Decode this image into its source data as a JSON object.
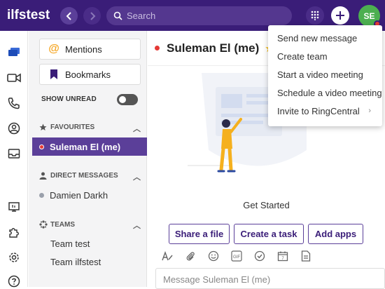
{
  "app": {
    "brand": "ilfstest"
  },
  "topbar": {
    "search_placeholder": "Search",
    "avatar_initials": "SE",
    "colors": {
      "bar": "#3a1d78",
      "avatar": "#4caf50",
      "status": "#e53935"
    }
  },
  "sidebar": {
    "mentions_label": "Mentions",
    "bookmarks_label": "Bookmarks",
    "show_unread_label": "SHOW UNREAD",
    "favourites": {
      "title": "FAVOURITES",
      "items": [
        {
          "label": "Suleman El (me)"
        }
      ]
    },
    "direct_messages": {
      "title": "DIRECT MESSAGES",
      "items": [
        {
          "label": "Damien Darkh"
        }
      ]
    },
    "teams": {
      "title": "TEAMS",
      "items": [
        {
          "label": "Team test"
        },
        {
          "label": "Team ilfstest"
        }
      ]
    }
  },
  "conversation": {
    "title": "Suleman El (me)",
    "get_started": "Get Started",
    "actions": [
      "Share a file",
      "Create a task",
      "Add apps"
    ],
    "compose_placeholder": "Message Suleman El (me)"
  },
  "dropdown": {
    "items": [
      {
        "label": "Send new message"
      },
      {
        "label": "Create team"
      },
      {
        "label": "Start a video meeting"
      },
      {
        "label": "Schedule a video meeting"
      },
      {
        "label": "Invite to RingCentral"
      }
    ]
  }
}
